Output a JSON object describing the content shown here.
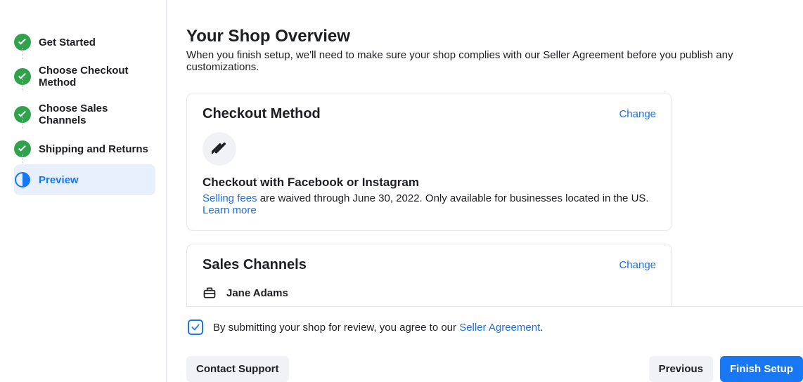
{
  "sidebar": {
    "steps": [
      {
        "label": "Get Started",
        "done": true
      },
      {
        "label": "Choose Checkout Method",
        "done": true
      },
      {
        "label": "Choose Sales Channels",
        "done": true
      },
      {
        "label": "Shipping and Returns",
        "done": true
      },
      {
        "label": "Preview",
        "active": true
      }
    ]
  },
  "page": {
    "title": "Your Shop Overview",
    "subtitle": "When you finish setup, we'll need to make sure your shop complies with our Seller Agreement before you publish any customizations."
  },
  "checkout": {
    "card_title": "Checkout Method",
    "change_label": "Change",
    "subhead": "Checkout with Facebook or Instagram",
    "fees_link": "Selling fees",
    "desc_mid": " are waived through June 30, 2022. Only available for businesses located in the US. ",
    "learn_more": "Learn more"
  },
  "channels": {
    "card_title": "Sales Channels",
    "change_label": "Change",
    "items": [
      {
        "name": "Jane Adams"
      }
    ]
  },
  "agree": {
    "prefix": "By submitting your shop for review, you agree to our ",
    "link": "Seller Agreement",
    "suffix": "."
  },
  "actions": {
    "contact": "Contact Support",
    "previous": "Previous",
    "finish": "Finish Setup"
  }
}
